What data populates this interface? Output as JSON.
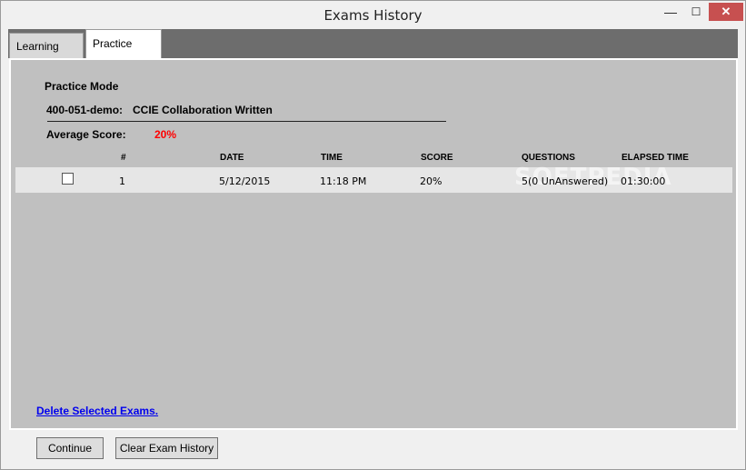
{
  "window": {
    "title": "Exams History",
    "minimize": "—",
    "maximize": "☐",
    "close": "✕"
  },
  "tabs": [
    {
      "label": "Learning Mode",
      "active": false
    },
    {
      "label": "Practice Mode",
      "active": true
    }
  ],
  "practice": {
    "heading": "Practice Mode",
    "exam_code": "400-051-demo:",
    "exam_name": "CCIE Collaboration Written",
    "average_label": "Average Score:",
    "average_value": "20%",
    "average_color": "#ff0000"
  },
  "table": {
    "headers": [
      "#",
      "DATE",
      "TIME",
      "SCORE",
      "QUESTIONS",
      "ELAPSED TIME"
    ],
    "rows": [
      {
        "checked": false,
        "num": "1",
        "date": "5/12/2015",
        "time": "11:18 PM",
        "score": "20%",
        "questions": "5(0 UnAnswered)",
        "elapsed": "01:30:00"
      }
    ]
  },
  "watermark": "SOFTPEDIA",
  "delete_link": "Delete Selected Exams.",
  "buttons": {
    "continue": "Continue",
    "clear": "Clear Exam History"
  },
  "colors": {
    "link": "#0000ee",
    "close_button": "#c75050",
    "content_bg": "#c0c0c0"
  }
}
